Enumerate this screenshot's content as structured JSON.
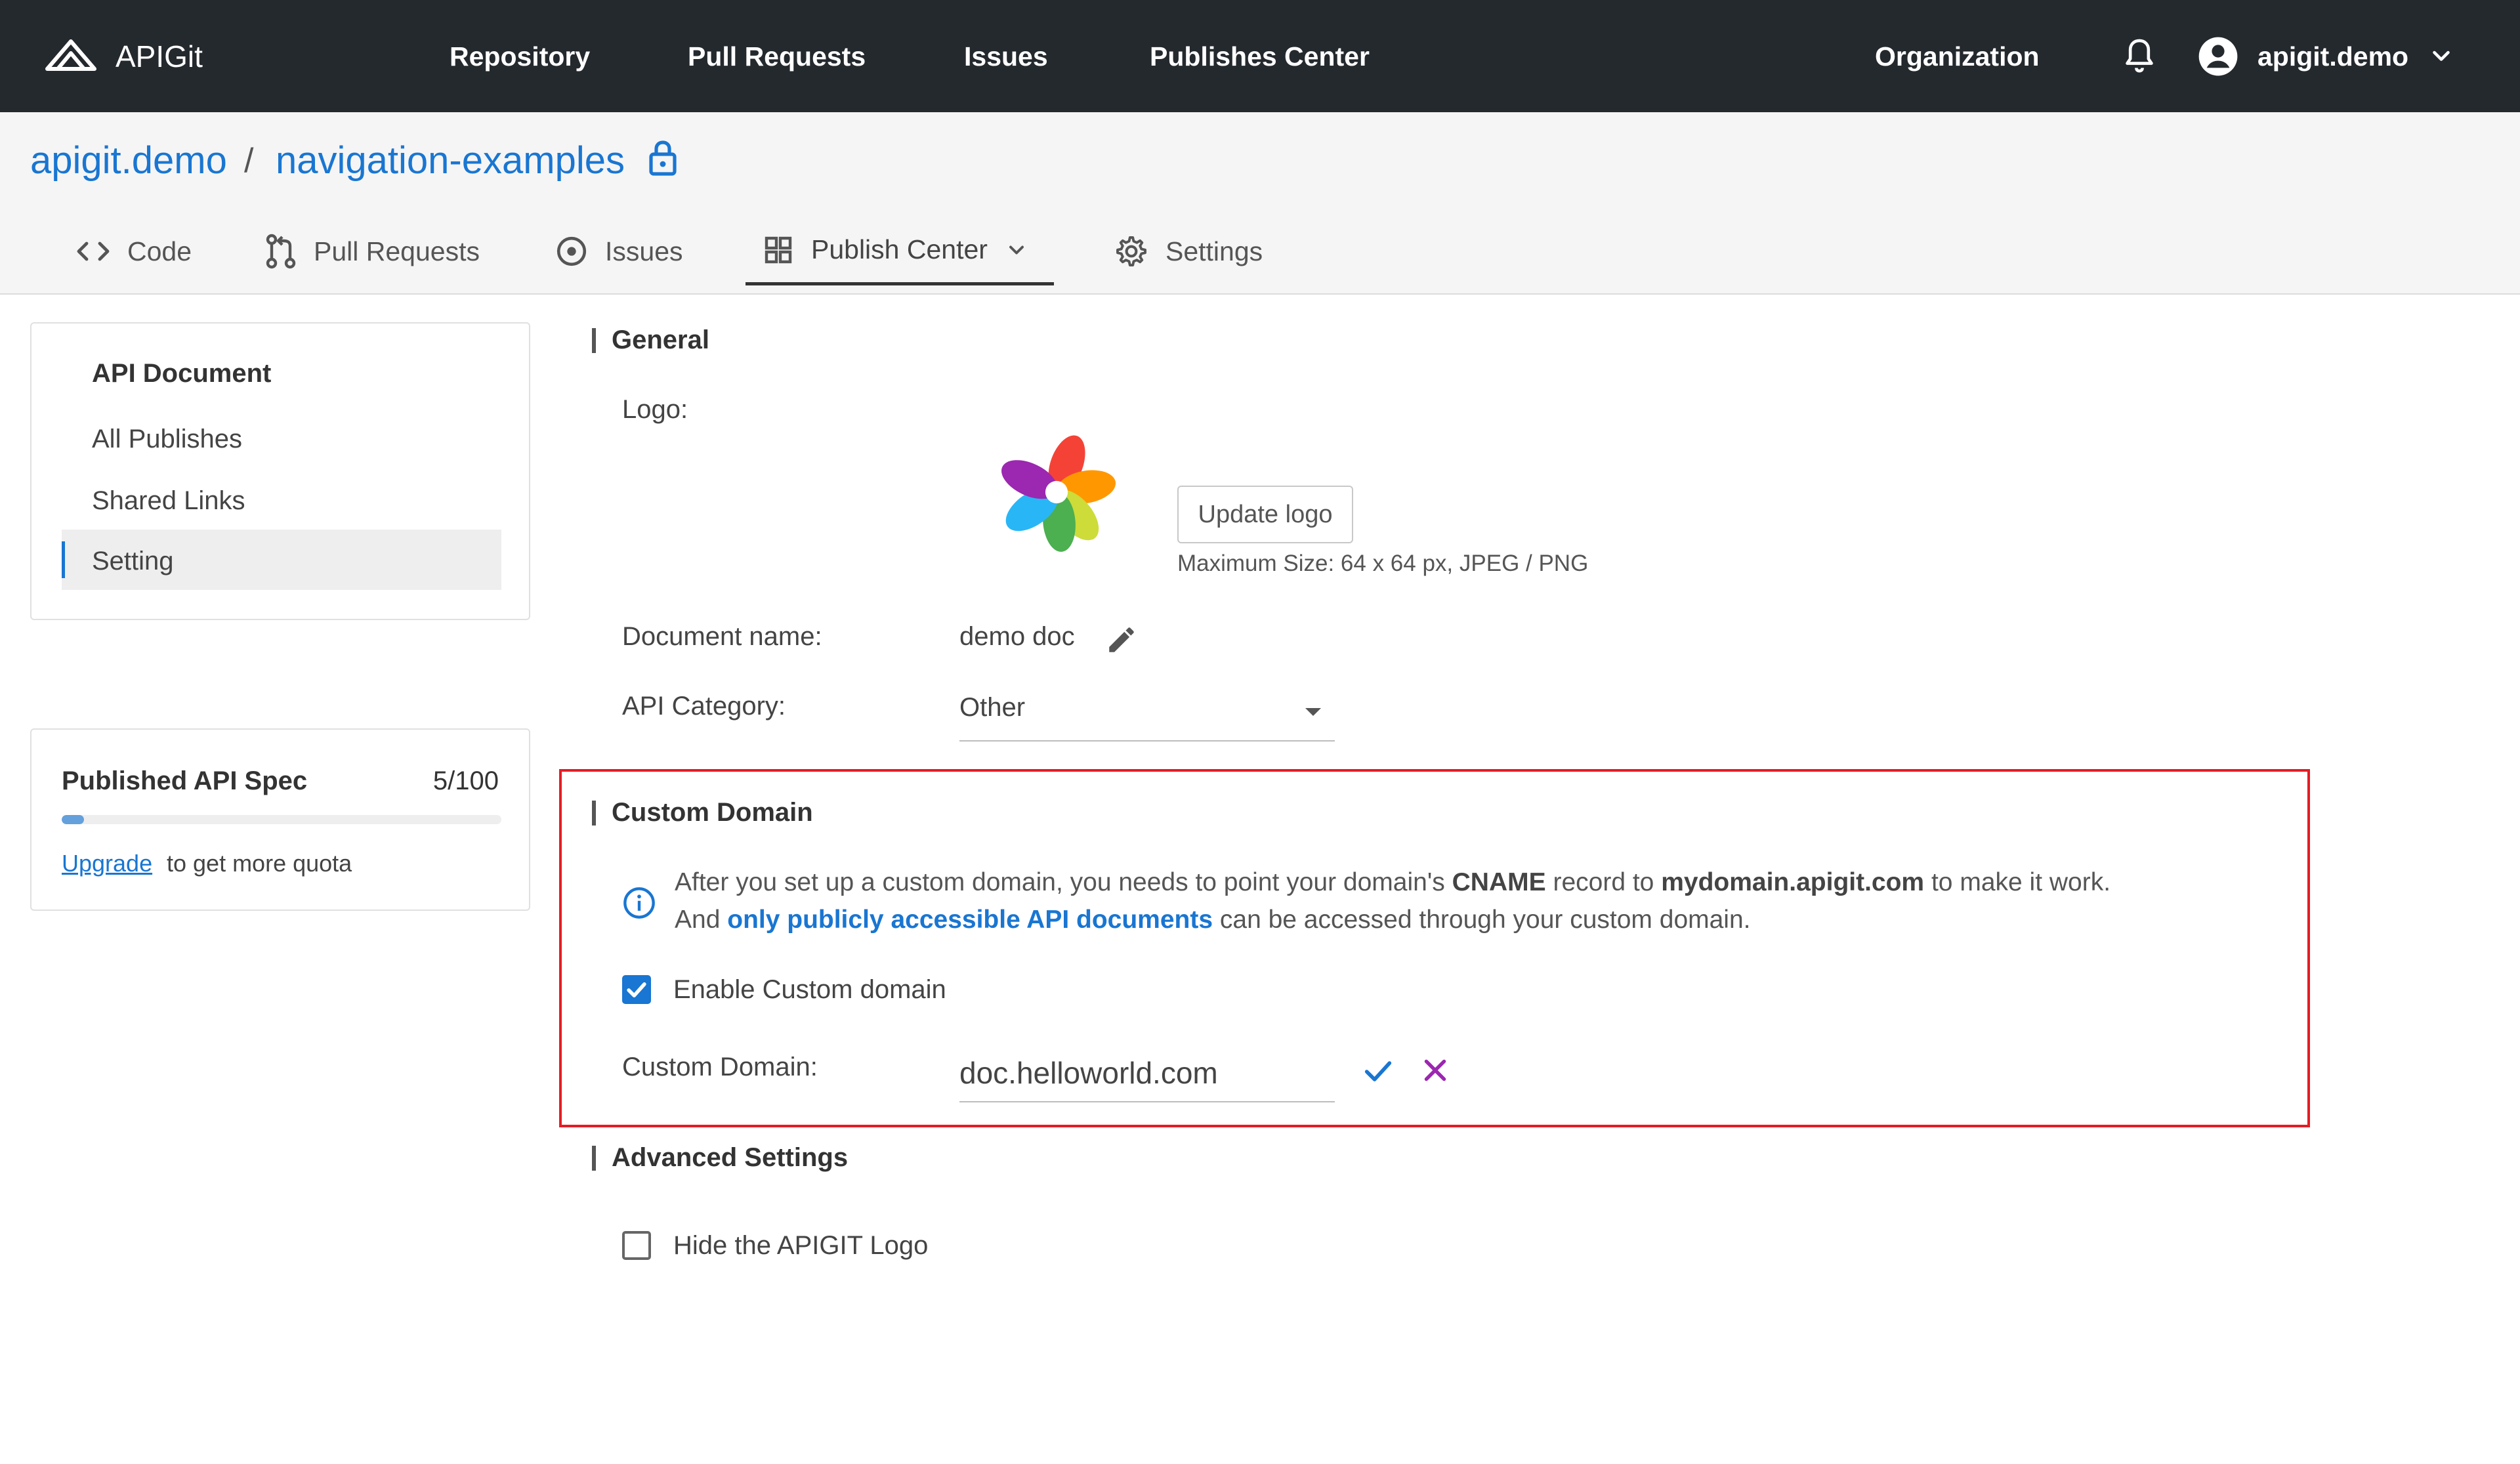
{
  "topbar": {
    "brand": "APIGit",
    "nav": [
      {
        "label": "Repository"
      },
      {
        "label": "Pull Requests"
      },
      {
        "label": "Issues"
      },
      {
        "label": "Publishes Center"
      }
    ],
    "organization": "Organization",
    "user": "apigit.demo",
    "icons": {
      "brand": "apigit-logo-icon",
      "notifications": "bell-icon",
      "avatar": "account-circle-icon",
      "menu": "chevron-down-icon"
    },
    "colors": {
      "background": "#24292e",
      "text": "#ffffff"
    }
  },
  "repo": {
    "owner": "apigit.demo",
    "separator": "/",
    "name": "navigation-examples",
    "visibility_icon": "lock-icon",
    "tabs": [
      {
        "label": "Code",
        "icon": "code-icon"
      },
      {
        "label": "Pull Requests",
        "icon": "pull-request-icon"
      },
      {
        "label": "Issues",
        "icon": "issue-icon"
      },
      {
        "label": "Publish Center",
        "icon": "grid-icon",
        "active": true
      },
      {
        "label": "Settings",
        "icon": "gear-icon"
      }
    ]
  },
  "sidebar": {
    "title": "API Document",
    "items": [
      {
        "label": "All Publishes"
      },
      {
        "label": "Shared Links"
      },
      {
        "label": "Setting",
        "active": true
      }
    ]
  },
  "quota": {
    "title": "Published API Spec",
    "count": "5/100",
    "fraction": 0.05,
    "upgrade": "Upgrade",
    "note": "to get more quota"
  },
  "general": {
    "title": "General",
    "logo_label": "Logo:",
    "update_logo": "Update logo",
    "logo_hint": "Maximum Size: 64 x 64 px, JPEG / PNG",
    "doc_name_label": "Document name:",
    "doc_name": "demo doc",
    "category_label": "API Category:",
    "category": "Other"
  },
  "custom_domain": {
    "title": "Custom Domain",
    "info_1": "After you set up a custom domain, you needs to point your domain's",
    "info_cname": "CNAME",
    "info_2": "record to",
    "info_host": "mydomain.apigit.com",
    "info_3": "to make it work.",
    "info_4": "And",
    "info_link": "only publicly accessible API documents",
    "info_5": "can be accessed through your custom domain.",
    "enable_label": "Enable Custom domain",
    "enabled": true,
    "field_label": "Custom Domain:",
    "field_value": "doc.helloworld.com",
    "highlight_color": "#e51c24"
  },
  "advanced": {
    "title": "Advanced Settings",
    "hide_logo_label": "Hide the APIGIT Logo",
    "hide_logo": false
  },
  "accent_color": "#1976d2"
}
